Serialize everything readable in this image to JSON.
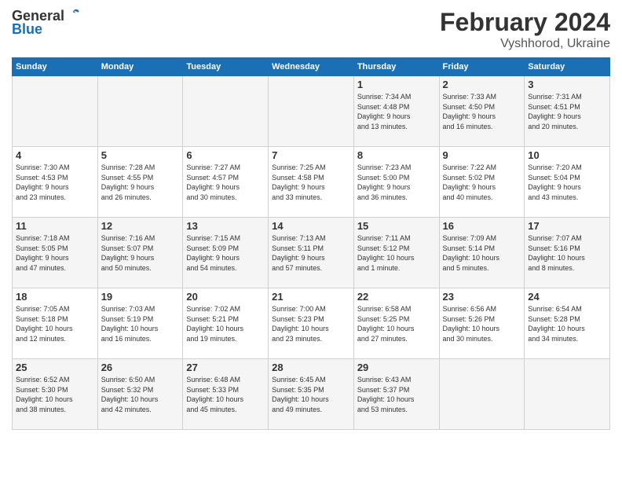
{
  "header": {
    "logo_general": "General",
    "logo_blue": "Blue",
    "title": "February 2024",
    "location": "Vyshhorod, Ukraine"
  },
  "days_of_week": [
    "Sunday",
    "Monday",
    "Tuesday",
    "Wednesday",
    "Thursday",
    "Friday",
    "Saturday"
  ],
  "weeks": [
    {
      "days": [
        {
          "number": "",
          "info": ""
        },
        {
          "number": "",
          "info": ""
        },
        {
          "number": "",
          "info": ""
        },
        {
          "number": "",
          "info": ""
        },
        {
          "number": "1",
          "info": "Sunrise: 7:34 AM\nSunset: 4:48 PM\nDaylight: 9 hours\nand 13 minutes."
        },
        {
          "number": "2",
          "info": "Sunrise: 7:33 AM\nSunset: 4:50 PM\nDaylight: 9 hours\nand 16 minutes."
        },
        {
          "number": "3",
          "info": "Sunrise: 7:31 AM\nSunset: 4:51 PM\nDaylight: 9 hours\nand 20 minutes."
        }
      ]
    },
    {
      "days": [
        {
          "number": "4",
          "info": "Sunrise: 7:30 AM\nSunset: 4:53 PM\nDaylight: 9 hours\nand 23 minutes."
        },
        {
          "number": "5",
          "info": "Sunrise: 7:28 AM\nSunset: 4:55 PM\nDaylight: 9 hours\nand 26 minutes."
        },
        {
          "number": "6",
          "info": "Sunrise: 7:27 AM\nSunset: 4:57 PM\nDaylight: 9 hours\nand 30 minutes."
        },
        {
          "number": "7",
          "info": "Sunrise: 7:25 AM\nSunset: 4:58 PM\nDaylight: 9 hours\nand 33 minutes."
        },
        {
          "number": "8",
          "info": "Sunrise: 7:23 AM\nSunset: 5:00 PM\nDaylight: 9 hours\nand 36 minutes."
        },
        {
          "number": "9",
          "info": "Sunrise: 7:22 AM\nSunset: 5:02 PM\nDaylight: 9 hours\nand 40 minutes."
        },
        {
          "number": "10",
          "info": "Sunrise: 7:20 AM\nSunset: 5:04 PM\nDaylight: 9 hours\nand 43 minutes."
        }
      ]
    },
    {
      "days": [
        {
          "number": "11",
          "info": "Sunrise: 7:18 AM\nSunset: 5:05 PM\nDaylight: 9 hours\nand 47 minutes."
        },
        {
          "number": "12",
          "info": "Sunrise: 7:16 AM\nSunset: 5:07 PM\nDaylight: 9 hours\nand 50 minutes."
        },
        {
          "number": "13",
          "info": "Sunrise: 7:15 AM\nSunset: 5:09 PM\nDaylight: 9 hours\nand 54 minutes."
        },
        {
          "number": "14",
          "info": "Sunrise: 7:13 AM\nSunset: 5:11 PM\nDaylight: 9 hours\nand 57 minutes."
        },
        {
          "number": "15",
          "info": "Sunrise: 7:11 AM\nSunset: 5:12 PM\nDaylight: 10 hours\nand 1 minute."
        },
        {
          "number": "16",
          "info": "Sunrise: 7:09 AM\nSunset: 5:14 PM\nDaylight: 10 hours\nand 5 minutes."
        },
        {
          "number": "17",
          "info": "Sunrise: 7:07 AM\nSunset: 5:16 PM\nDaylight: 10 hours\nand 8 minutes."
        }
      ]
    },
    {
      "days": [
        {
          "number": "18",
          "info": "Sunrise: 7:05 AM\nSunset: 5:18 PM\nDaylight: 10 hours\nand 12 minutes."
        },
        {
          "number": "19",
          "info": "Sunrise: 7:03 AM\nSunset: 5:19 PM\nDaylight: 10 hours\nand 16 minutes."
        },
        {
          "number": "20",
          "info": "Sunrise: 7:02 AM\nSunset: 5:21 PM\nDaylight: 10 hours\nand 19 minutes."
        },
        {
          "number": "21",
          "info": "Sunrise: 7:00 AM\nSunset: 5:23 PM\nDaylight: 10 hours\nand 23 minutes."
        },
        {
          "number": "22",
          "info": "Sunrise: 6:58 AM\nSunset: 5:25 PM\nDaylight: 10 hours\nand 27 minutes."
        },
        {
          "number": "23",
          "info": "Sunrise: 6:56 AM\nSunset: 5:26 PM\nDaylight: 10 hours\nand 30 minutes."
        },
        {
          "number": "24",
          "info": "Sunrise: 6:54 AM\nSunset: 5:28 PM\nDaylight: 10 hours\nand 34 minutes."
        }
      ]
    },
    {
      "days": [
        {
          "number": "25",
          "info": "Sunrise: 6:52 AM\nSunset: 5:30 PM\nDaylight: 10 hours\nand 38 minutes."
        },
        {
          "number": "26",
          "info": "Sunrise: 6:50 AM\nSunset: 5:32 PM\nDaylight: 10 hours\nand 42 minutes."
        },
        {
          "number": "27",
          "info": "Sunrise: 6:48 AM\nSunset: 5:33 PM\nDaylight: 10 hours\nand 45 minutes."
        },
        {
          "number": "28",
          "info": "Sunrise: 6:45 AM\nSunset: 5:35 PM\nDaylight: 10 hours\nand 49 minutes."
        },
        {
          "number": "29",
          "info": "Sunrise: 6:43 AM\nSunset: 5:37 PM\nDaylight: 10 hours\nand 53 minutes."
        },
        {
          "number": "",
          "info": ""
        },
        {
          "number": "",
          "info": ""
        }
      ]
    }
  ]
}
